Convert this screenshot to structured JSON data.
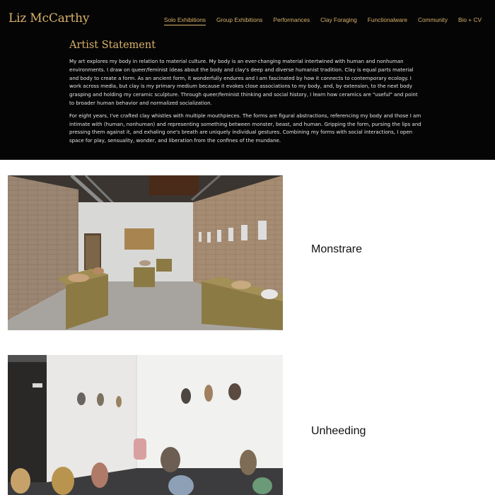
{
  "header": {
    "site_title": "Liz McCarthy",
    "nav": [
      {
        "label": "Solo Exhibitions",
        "active": true
      },
      {
        "label": "Group Exhibitions",
        "active": false
      },
      {
        "label": "Performances",
        "active": false
      },
      {
        "label": "Clay Foraging",
        "active": false
      },
      {
        "label": "Functionalware",
        "active": false
      },
      {
        "label": "Community",
        "active": false
      },
      {
        "label": "Bio + CV",
        "active": false
      }
    ]
  },
  "statement": {
    "heading": "Artist Statement",
    "paragraphs": [
      "My art explores my body in relation to material culture. My body is an ever-changing material intertwined with human and nonhuman environments. I draw on queer/feminist ideas about the body and clay's deep and diverse humanist tradition. Clay is equal parts material and body to create a form. As an ancient form, it wonderfully endures and I am fascinated by how it connects to contemporary ecology. I work across media, but clay is my primary medium because it evokes close associations to my body, and, by extension, to the next body grasping and holding my ceramic sculpture. Through queer/feminist thinking and social history, I learn how ceramics are \"useful\" and point to broader human behavior and normalized socialization.",
      "For eight years, I've crafted clay whistles with multiple mouthpieces. The forms are figural abstractions, referencing my body and those I am intimate with (human, nonhuman) and representing something between monster, beast, and human. Gripping the form, pursing the lips and pressing them against it, and exhaling one's breath are uniquely individual gestures. Combining my forms with social interactions, I open space for play, sensuality, wonder, and liberation from the confines of the mundane."
    ]
  },
  "exhibitions": [
    {
      "title": "Monstrare"
    },
    {
      "title": "Unheeding"
    }
  ],
  "colors": {
    "header_bg": "#050505",
    "accent_gold": "#d9b26a",
    "body_text": "#e8e8e8",
    "page_bg": "#ffffff"
  }
}
